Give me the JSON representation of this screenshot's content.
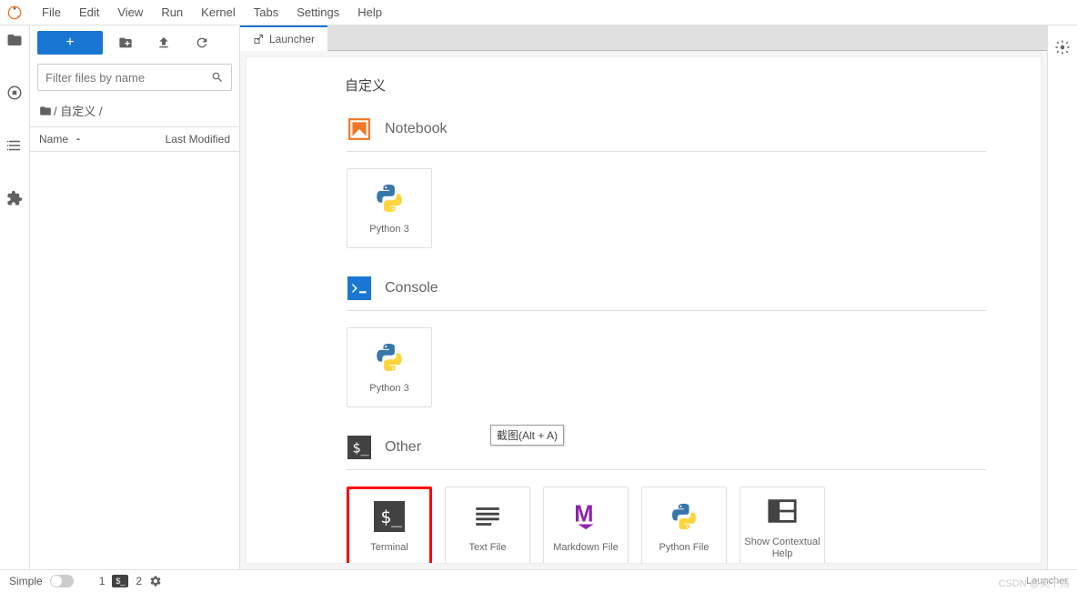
{
  "menu": {
    "file": "File",
    "edit": "Edit",
    "view": "View",
    "run": "Run",
    "kernel": "Kernel",
    "tabs": "Tabs",
    "settings": "Settings",
    "help": "Help"
  },
  "filePanel": {
    "filterPlaceholder": "Filter files by name",
    "breadcrumb": " / 自定义 /",
    "colName": "Name",
    "colMod": "Last Modified"
  },
  "tab": {
    "label": "Launcher"
  },
  "launcher": {
    "cwd": "自定义",
    "sections": {
      "notebook": {
        "title": "Notebook",
        "card": "Python 3"
      },
      "console": {
        "title": "Console",
        "card": "Python 3"
      },
      "other": {
        "title": "Other",
        "terminal": "Terminal",
        "textfile": "Text File",
        "markdown": "Markdown File",
        "pyfile": "Python File",
        "contexthelp": "Show Contextual Help"
      }
    }
  },
  "tooltip": "截图(Alt + A)",
  "status": {
    "simple": "Simple",
    "count1": "1",
    "count2": "2",
    "right": "Launcher",
    "watermark": "CSDN @奕千殇"
  }
}
